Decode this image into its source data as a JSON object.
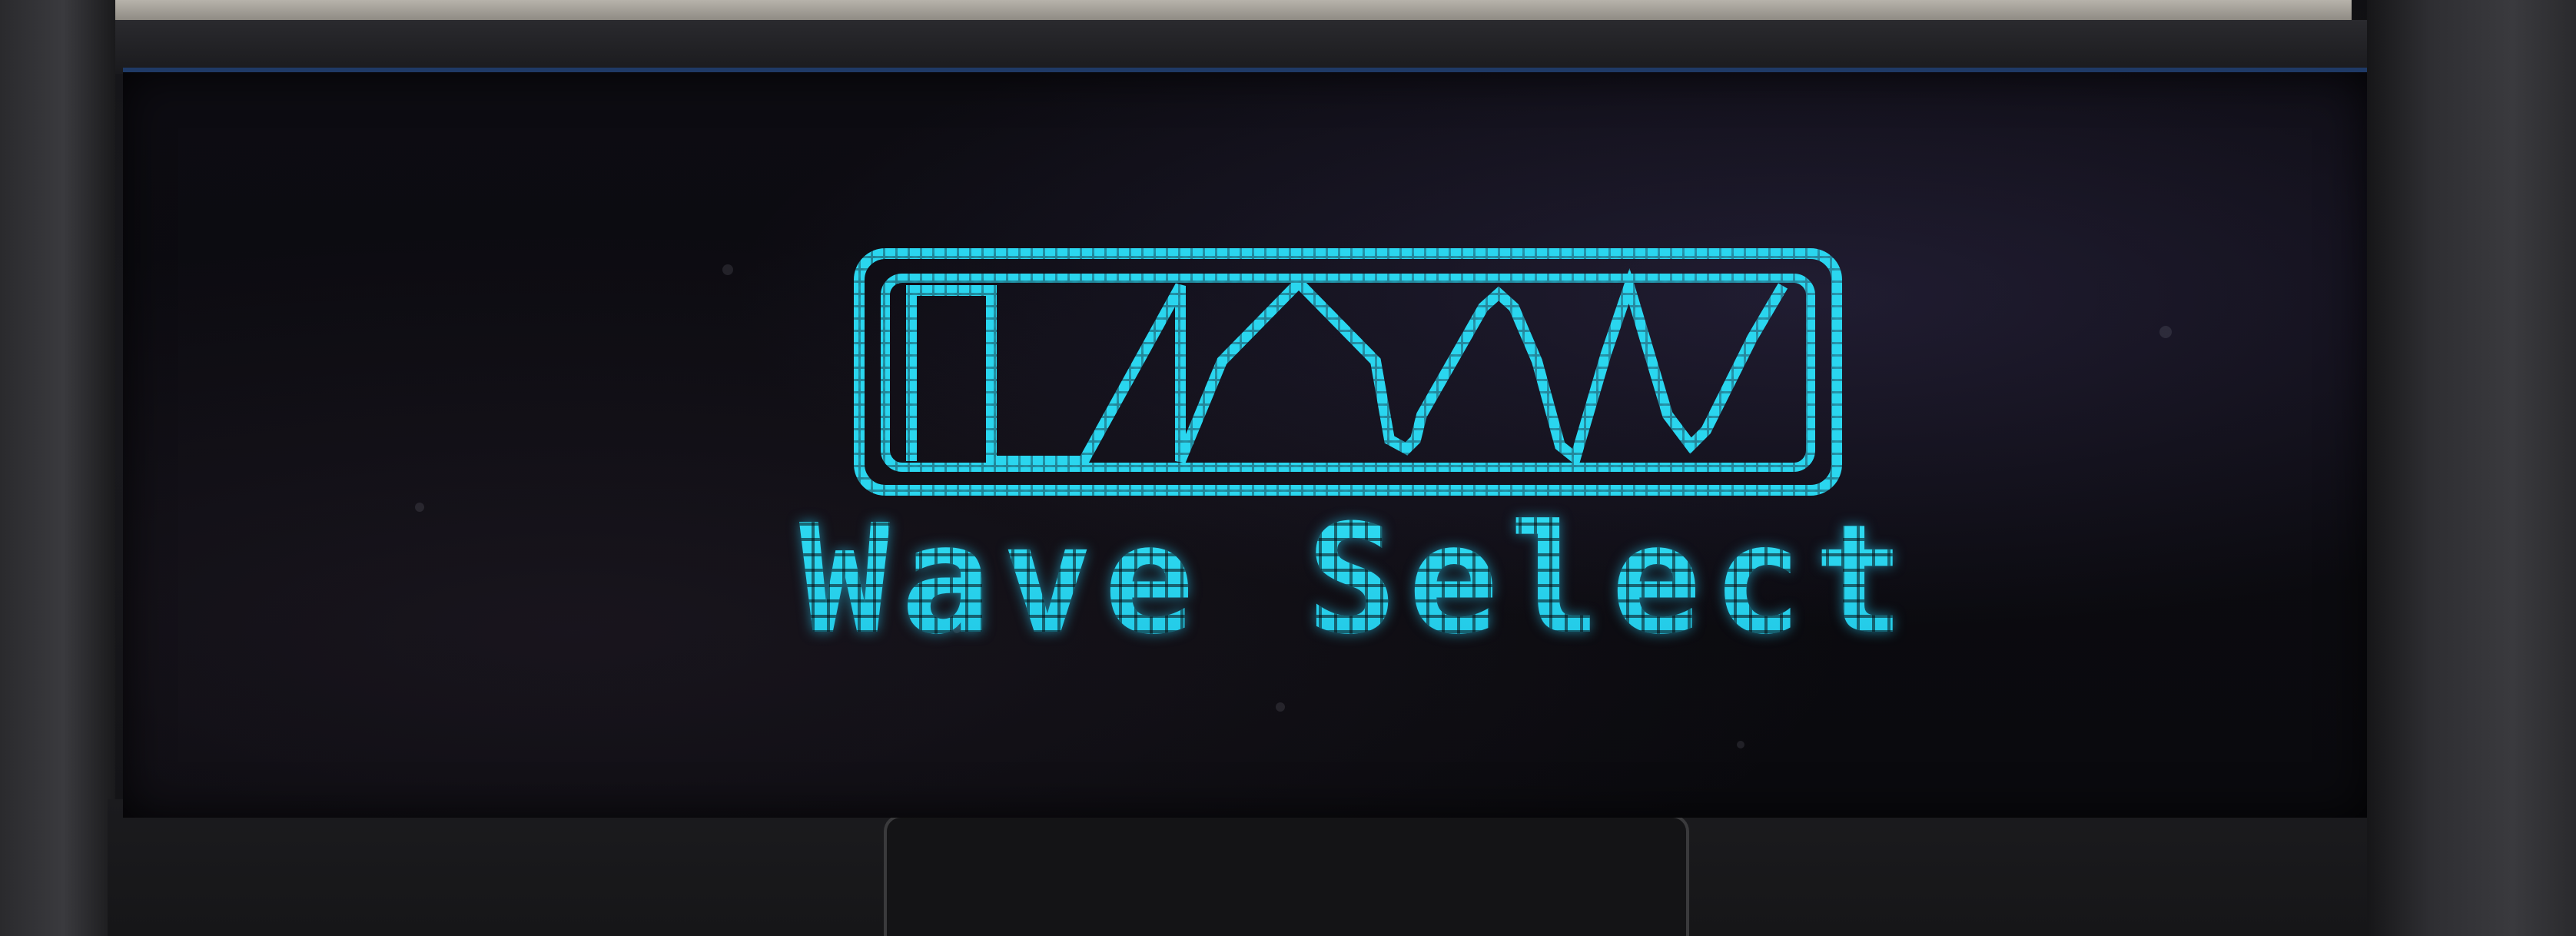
{
  "screen": {
    "title": "Wave Select",
    "waveform_icon": "waveform-preview-icon",
    "waveforms_shown": [
      "square",
      "sawtooth",
      "triangle",
      "reverse-sawtooth"
    ]
  },
  "colors": {
    "oled_pixel": "#2ad6ef",
    "oled_glow": "#1fb7dc",
    "panel_background": "#0b0b10",
    "bezel": "#2e2e32"
  }
}
